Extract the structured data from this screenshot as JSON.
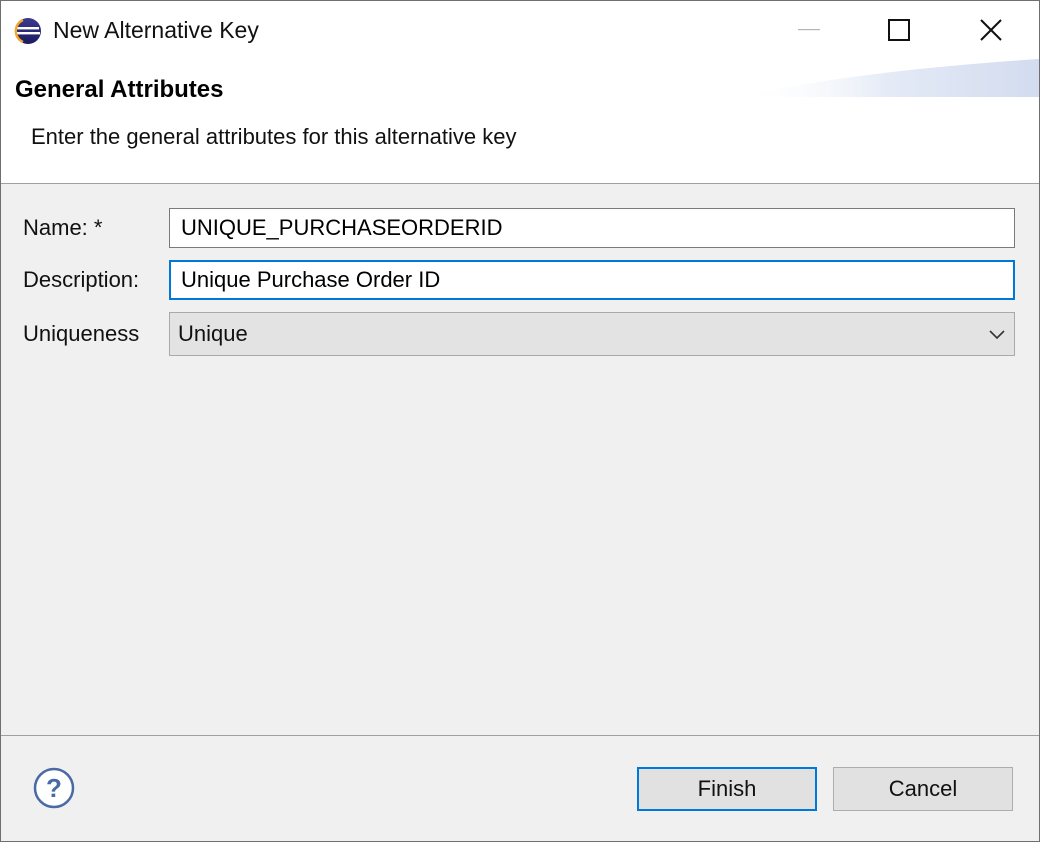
{
  "window": {
    "title": "New Alternative Key",
    "app_icon": "eclipse-icon",
    "controls": [
      "minimize-icon",
      "maximize-icon",
      "close-icon"
    ]
  },
  "header": {
    "title": "General Attributes",
    "description": "Enter the general attributes for this alternative key"
  },
  "form": {
    "name": {
      "label": "Name: *",
      "value": "UNIQUE_PURCHASEORDERID"
    },
    "description": {
      "label": "Description:",
      "value": "Unique Purchase Order ID"
    },
    "uniqueness": {
      "label": "Uniqueness",
      "selected": "Unique"
    }
  },
  "footer": {
    "help_icon": "help-icon",
    "finish_label": "Finish",
    "cancel_label": "Cancel"
  },
  "colors": {
    "focus_accent": "#0078d7",
    "dialog_bg": "#f0f0f0",
    "header_bg": "#ffffff"
  }
}
